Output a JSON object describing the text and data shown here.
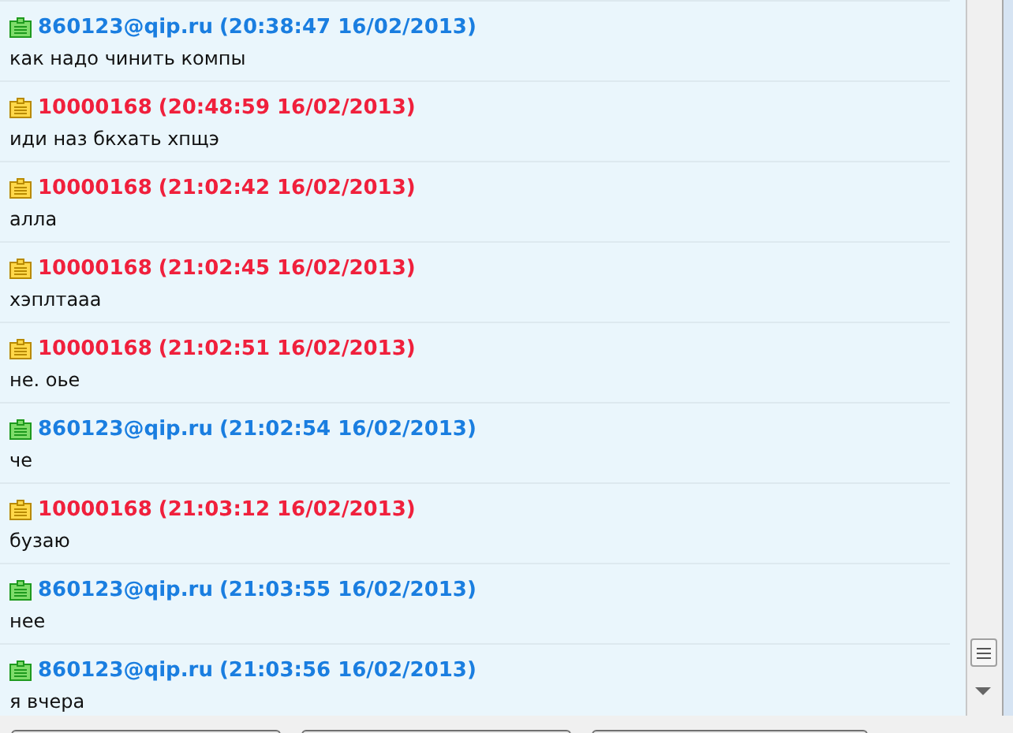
{
  "messages": [
    {
      "kind": "outgoing",
      "author": "860123@qip.ru",
      "time": "(20:38:47 16/02/2013)",
      "text": "как надо чинить компы"
    },
    {
      "kind": "incoming",
      "author": "10000168",
      "time": "(20:48:59 16/02/2013)",
      "text": "иди наз бкхать хпщэ"
    },
    {
      "kind": "incoming",
      "author": "10000168",
      "time": "(21:02:42 16/02/2013)",
      "text": "алла"
    },
    {
      "kind": "incoming",
      "author": "10000168",
      "time": "(21:02:45 16/02/2013)",
      "text": "хэплтааа"
    },
    {
      "kind": "incoming",
      "author": "10000168",
      "time": "(21:02:51 16/02/2013)",
      "text": "не. оье"
    },
    {
      "kind": "outgoing",
      "author": "860123@qip.ru",
      "time": "(21:02:54 16/02/2013)",
      "text": "че"
    },
    {
      "kind": "incoming",
      "author": "10000168",
      "time": "(21:03:12 16/02/2013)",
      "text": "бузаю"
    },
    {
      "kind": "outgoing",
      "author": "860123@qip.ru",
      "time": "(21:03:55 16/02/2013)",
      "text": "нее"
    },
    {
      "kind": "outgoing",
      "author": "860123@qip.ru",
      "time": "(21:03:56 16/02/2013)",
      "text": "я вчера"
    }
  ]
}
